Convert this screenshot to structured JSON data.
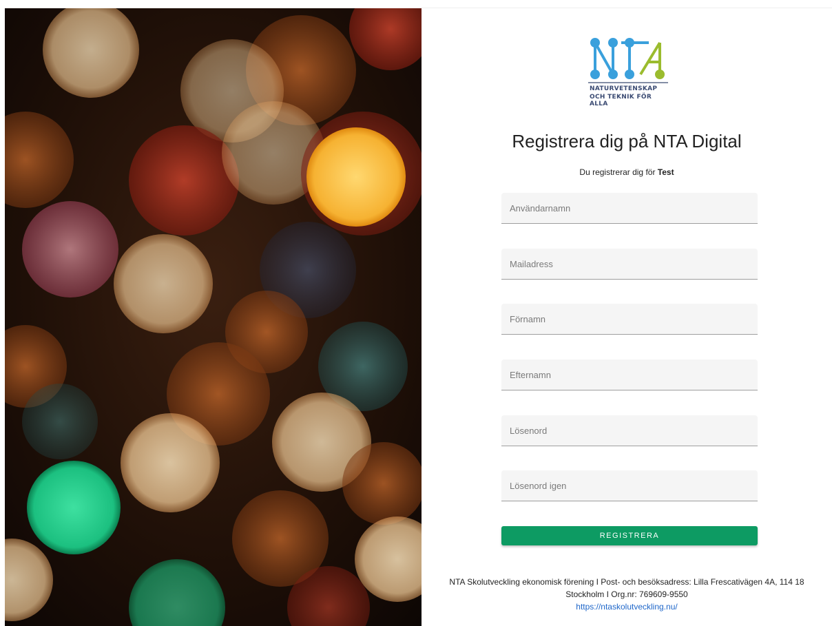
{
  "logo": {
    "brand_letters": "NTA",
    "line1": "NATURVETENSKAP",
    "line2": "OCH TEKNIK FÖR ALLA",
    "colors": {
      "blue": "#3aa0dc",
      "green": "#9bbc2e",
      "navy": "#3a4a72"
    }
  },
  "page": {
    "title": "Registrera dig på NTA Digital",
    "subtitle_prefix": "Du registrerar dig för",
    "subtitle_org": "Test"
  },
  "form": {
    "fields": [
      {
        "placeholder": "Användarnamn",
        "value": ""
      },
      {
        "placeholder": "Mailadress",
        "value": ""
      },
      {
        "placeholder": "Förnamn",
        "value": ""
      },
      {
        "placeholder": "Efternamn",
        "value": ""
      },
      {
        "placeholder": "Lösenord",
        "value": ""
      },
      {
        "placeholder": "Lösenord igen",
        "value": ""
      }
    ],
    "submit_label": "REGISTRERA",
    "submit_color": "#0d9b63"
  },
  "footer": {
    "line1": "NTA Skolutveckling ekonomisk förening I Post- och besöksadress: Lilla Frescativägen 4A, 114 18",
    "line2": "Stockholm I Org.nr: 769609-9550",
    "link": "https://ntaskolutveckling.nu/"
  },
  "hero": {
    "description": "bokeh-lights-image"
  }
}
